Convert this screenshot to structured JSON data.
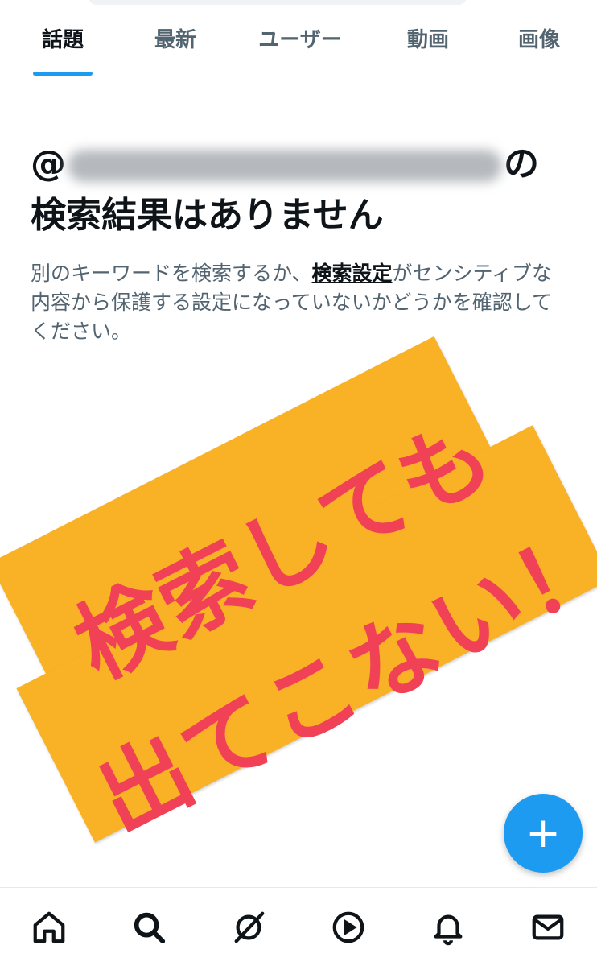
{
  "tabs": [
    {
      "label": "話題",
      "active": true
    },
    {
      "label": "最新",
      "active": false
    },
    {
      "label": "ユーザー",
      "active": false
    },
    {
      "label": "動画",
      "active": false
    },
    {
      "label": "画像",
      "active": false
    }
  ],
  "empty_state": {
    "title_prefix": "@",
    "title_suffix": "の",
    "title_line2": "検索結果はありません",
    "body_before_link": "別のキーワードを検索するか、",
    "body_link": "検索設定",
    "body_after_link": "がセンシティブな内容から保護する設定になっていないかどうかを確認してください。"
  },
  "overlay": {
    "line1": "検索しても",
    "line2": "出てこない！",
    "text_color": "#f14157",
    "sticker_color": "#f9b226"
  },
  "fab": {
    "icon": "plus-icon",
    "label": "+"
  },
  "bottom_nav": [
    {
      "icon": "home-icon"
    },
    {
      "icon": "search-icon"
    },
    {
      "icon": "spaces-icon"
    },
    {
      "icon": "video-play-icon"
    },
    {
      "icon": "bell-icon"
    },
    {
      "icon": "mail-icon"
    }
  ],
  "colors": {
    "accent": "#1d9bf0",
    "text": "#0f1419",
    "muted": "#536471"
  }
}
